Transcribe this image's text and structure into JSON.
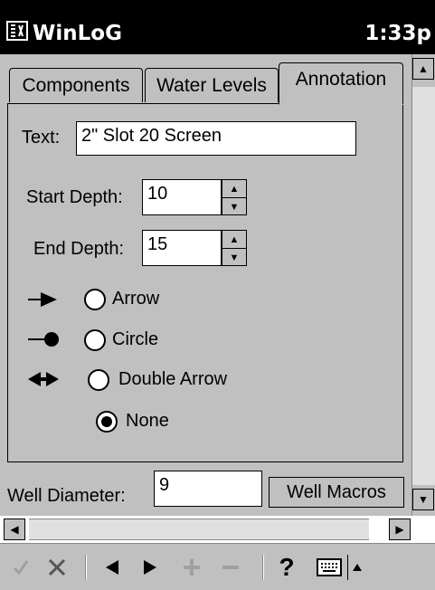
{
  "title_bar": {
    "app_title": "WinLoG",
    "clock": "1:33p"
  },
  "tabs": [
    {
      "label": "Components",
      "active": false
    },
    {
      "label": "Water Levels",
      "active": false
    },
    {
      "label": "Annotation",
      "active": true
    }
  ],
  "annotation": {
    "text_label": "Text:",
    "text_value": "2\" Slot 20 Screen",
    "start_depth_label": "Start Depth:",
    "start_depth_value": "10",
    "end_depth_label": "End Depth:",
    "end_depth_value": "15",
    "symbol_options": [
      {
        "label": "Arrow",
        "icon": "arrow-right-icon",
        "selected": false
      },
      {
        "label": "Circle",
        "icon": "circle-pin-icon",
        "selected": false
      },
      {
        "label": "Double Arrow",
        "icon": "double-arrow-icon",
        "selected": false
      },
      {
        "label": "None",
        "icon": "",
        "selected": true
      }
    ]
  },
  "well": {
    "diameter_label": "Well Diameter:",
    "diameter_value": "9",
    "macros_button": "Well Macros"
  },
  "toolbar": {
    "items": [
      "check-icon",
      "x-icon",
      "left-triangle-icon",
      "right-triangle-icon",
      "plus-icon",
      "minus-icon",
      "help-icon",
      "keyboard-icon",
      "up-caret-icon"
    ],
    "help": "?"
  },
  "colors": {
    "titlebar": "#000000",
    "window": "#c0c0c0",
    "field": "#ffffff",
    "disabled": "#a0a0a0"
  }
}
